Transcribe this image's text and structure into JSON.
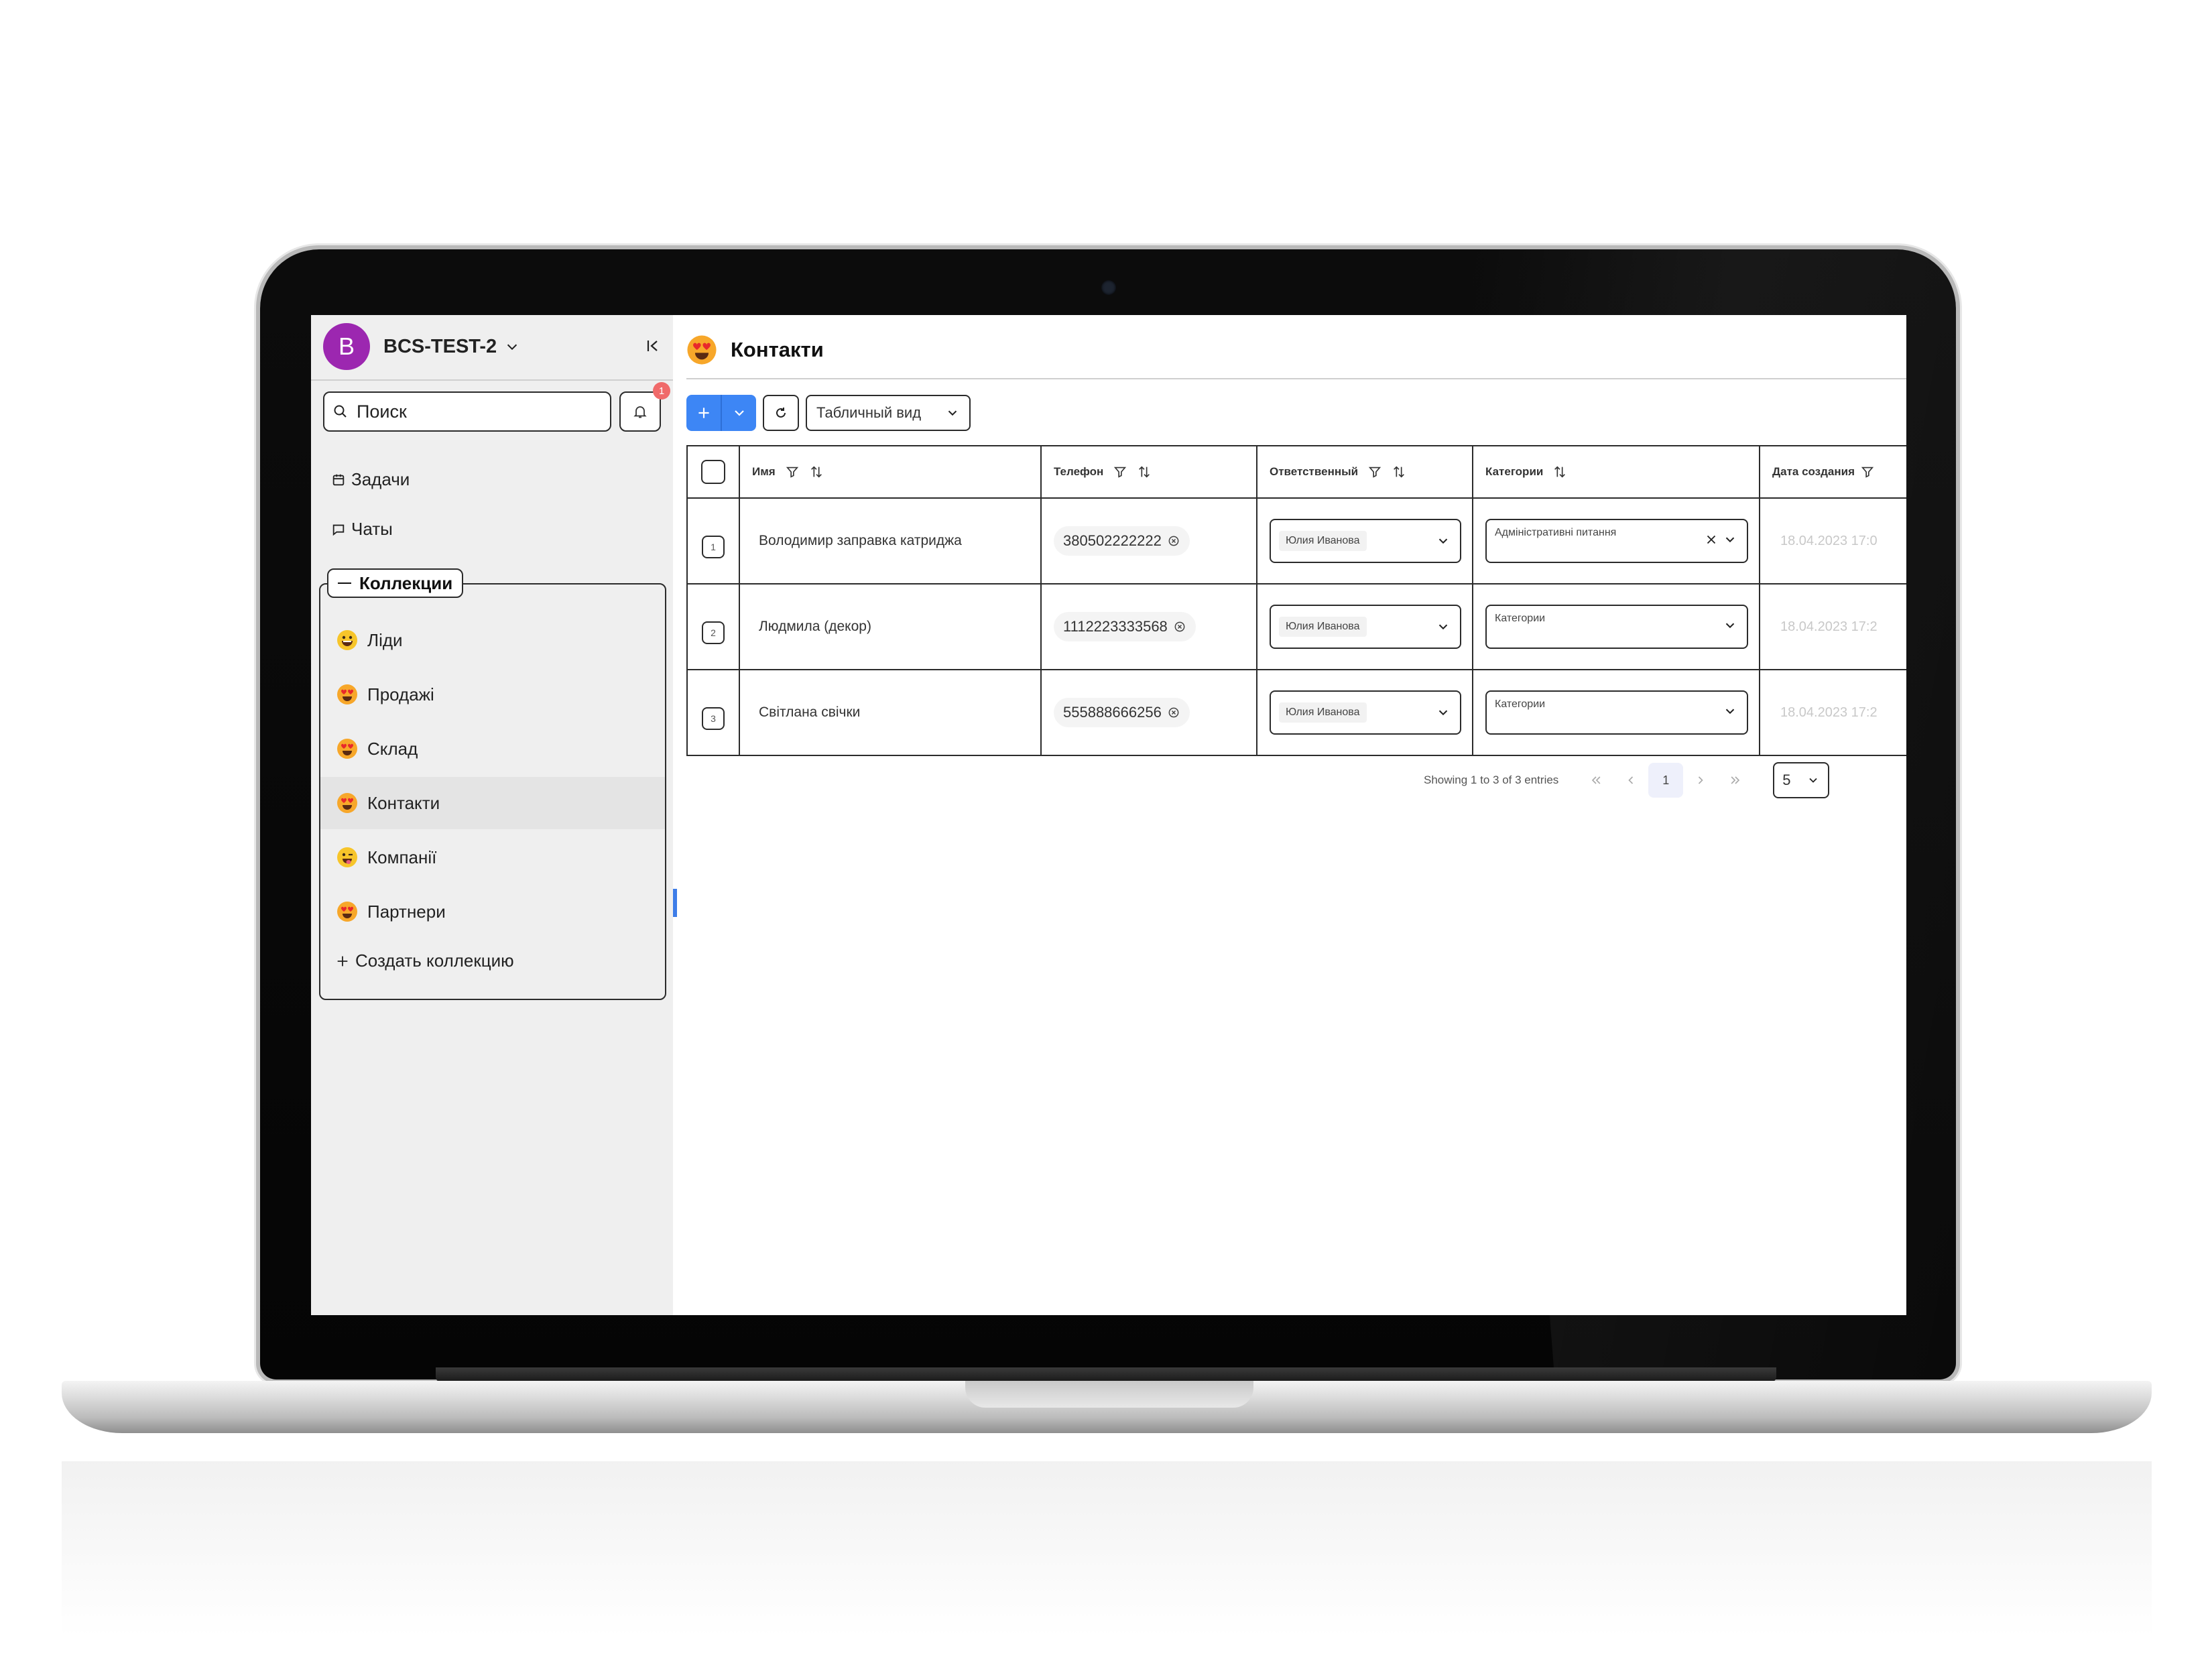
{
  "workspace": {
    "avatar_letter": "B",
    "name": "BCS-TEST-2",
    "avatar_color": "#9c27b0"
  },
  "search": {
    "placeholder": "Поиск"
  },
  "notifications": {
    "count": "1"
  },
  "nav": {
    "tasks": "Задачи",
    "chats": "Чаты"
  },
  "collections": {
    "header": "Коллекции",
    "items": [
      {
        "label": "Ліди",
        "icon": "grinning-face-emoji"
      },
      {
        "label": "Продажі",
        "icon": "heart-eyes-emoji"
      },
      {
        "label": "Склад",
        "icon": "heart-eyes-emoji"
      },
      {
        "label": "Контакти",
        "icon": "heart-eyes-emoji",
        "active": true
      },
      {
        "label": "Компанії",
        "icon": "tongue-face-emoji"
      },
      {
        "label": "Партнери",
        "icon": "heart-eyes-emoji"
      }
    ],
    "create_label": "Создать коллекцию"
  },
  "page": {
    "title": "Контакти",
    "icon": "heart-eyes-emoji"
  },
  "toolbar": {
    "view_label": "Табличный вид",
    "accent": "#3d86f5"
  },
  "table": {
    "columns": [
      "Имя",
      "Телефон",
      "Ответственный",
      "Категории",
      "Дата создания"
    ],
    "rows": [
      {
        "num": "1",
        "name": "Володимир заправка катриджа",
        "phone": "380502222222",
        "responsible": "Юлия Иванова",
        "category": "Адміністративні питання",
        "date": "18.04.2023 17:0"
      },
      {
        "num": "2",
        "name": "Людмила (декор)",
        "phone": "1112223333568",
        "responsible": "Юлия Иванова",
        "category": "Категории",
        "date": "18.04.2023 17:2"
      },
      {
        "num": "3",
        "name": "Світлана свічки",
        "phone": "555888666256",
        "responsible": "Юлия Иванова",
        "category": "Категории",
        "date": "18.04.2023 17:2"
      }
    ]
  },
  "pagination": {
    "info": "Showing 1 to 3 of 3 entries",
    "current_page": "1",
    "page_size": "5"
  }
}
